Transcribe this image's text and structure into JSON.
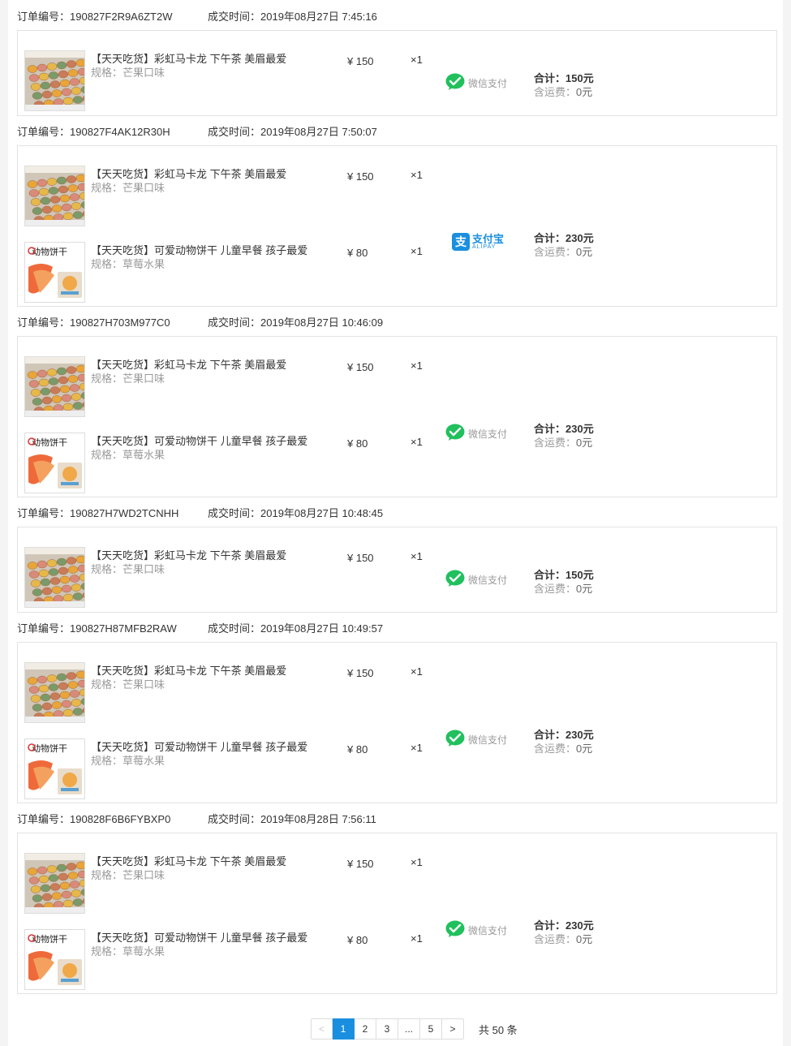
{
  "labels": {
    "order_no": "订单编号：",
    "deal_time": "成交时间：",
    "total": "合计：",
    "shipping": "含运费："
  },
  "payment_methods": {
    "wechat": {
      "label": "微信支付",
      "color": "#20c05c",
      "icon": "wechat-pay-icon"
    },
    "alipay": {
      "label": "支付宝",
      "sub": "ALIPAY",
      "color": "#1a8fe0",
      "icon": "alipay-icon"
    }
  },
  "products": {
    "macaron": {
      "name": "【天天吃货】彩虹马卡龙 下午茶 美眉最爱",
      "spec": "规格：芒果口味",
      "price": "¥ 150",
      "qty": "×1",
      "image": "macaron-image"
    },
    "biscuit": {
      "name": "【天天吃货】可爱动物饼干 儿童早餐 孩子最爱",
      "spec": "规格：草莓水果",
      "price": "¥ 80",
      "qty": "×1",
      "image": "animal-biscuit-image"
    }
  },
  "orders": [
    {
      "no": "190827F2R9A6ZT2W",
      "time": "2019年08月27日 7:45:16",
      "items": [
        "macaron"
      ],
      "pay": "wechat",
      "total": "150元",
      "shipping": "0元"
    },
    {
      "no": "190827F4AK12R30H",
      "time": "2019年08月27日 7:50:07",
      "items": [
        "macaron",
        "biscuit"
      ],
      "pay": "alipay",
      "total": "230元",
      "shipping": "0元"
    },
    {
      "no": "190827H703M977C0",
      "time": "2019年08月27日 10:46:09",
      "items": [
        "macaron",
        "biscuit"
      ],
      "pay": "wechat",
      "total": "230元",
      "shipping": "0元"
    },
    {
      "no": "190827H7WD2TCNHH",
      "time": "2019年08月27日 10:48:45",
      "items": [
        "macaron"
      ],
      "pay": "wechat",
      "total": "150元",
      "shipping": "0元"
    },
    {
      "no": "190827H87MFB2RAW",
      "time": "2019年08月27日 10:49:57",
      "items": [
        "macaron",
        "biscuit"
      ],
      "pay": "wechat",
      "total": "230元",
      "shipping": "0元"
    },
    {
      "no": "190828F6B6FYBXP0",
      "time": "2019年08月28日 7:56:11",
      "items": [
        "macaron",
        "biscuit"
      ],
      "pay": "wechat",
      "total": "230元",
      "shipping": "0元"
    }
  ],
  "pagination": {
    "prev": "<",
    "pages": [
      "1",
      "2",
      "3",
      "...",
      "5"
    ],
    "current": "1",
    "next": ">",
    "total_text": "共 50 条"
  }
}
